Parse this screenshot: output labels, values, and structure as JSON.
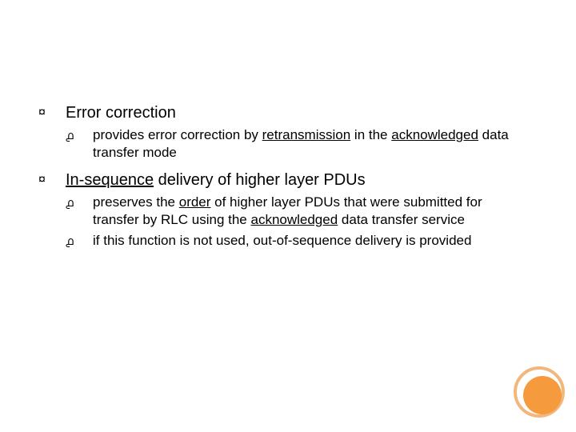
{
  "bullets": [
    {
      "label": "Error correction",
      "underline": false,
      "sub": [
        {
          "segments": [
            {
              "t": "provides error correction by ",
              "u": false
            },
            {
              "t": "retransmission",
              "u": true
            },
            {
              "t": " in the ",
              "u": false
            },
            {
              "t": "acknowledged",
              "u": true
            },
            {
              "t": " data transfer mode",
              "u": false
            }
          ]
        }
      ]
    },
    {
      "label_segments": [
        {
          "t": "In-sequence",
          "u": true
        },
        {
          "t": " delivery of higher layer PDUs",
          "u": false
        }
      ],
      "sub": [
        {
          "segments": [
            {
              "t": "preserves the ",
              "u": false
            },
            {
              "t": "order",
              "u": true
            },
            {
              "t": " of higher layer PDUs that were submitted for transfer by RLC using the ",
              "u": false
            },
            {
              "t": "acknowledged",
              "u": true
            },
            {
              "t": " data transfer service",
              "u": false
            }
          ]
        },
        {
          "segments": [
            {
              "t": "if this function is not used, out-of-sequence delivery is provided",
              "u": false
            }
          ]
        }
      ]
    }
  ],
  "glyphs": {
    "lvl1": "¤",
    "lvl2": "൧"
  }
}
